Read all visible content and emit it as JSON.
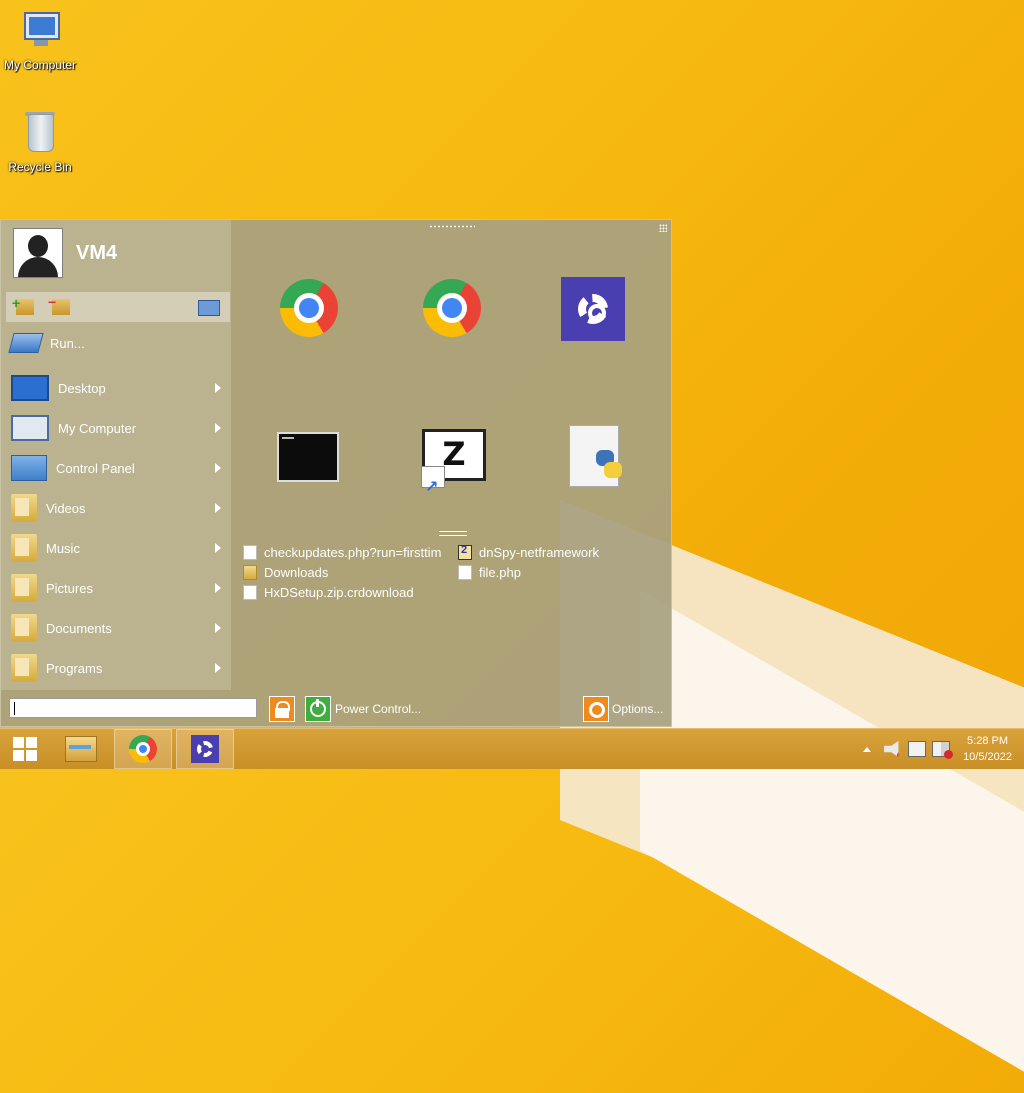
{
  "desktop": {
    "icons": [
      {
        "label": "My Computer",
        "icon": "computer-icon"
      },
      {
        "label": "Recycle Bin",
        "icon": "recycle-bin-icon"
      }
    ]
  },
  "start_menu": {
    "user": {
      "name": "VM4"
    },
    "items": [
      {
        "label": "Run...",
        "icon": "run-icon",
        "has_submenu": false
      },
      {
        "label": "Desktop",
        "icon": "desktop-icon",
        "has_submenu": true
      },
      {
        "label": "My Computer",
        "icon": "computer-icon",
        "has_submenu": true
      },
      {
        "label": "Control Panel",
        "icon": "control-panel-icon",
        "has_submenu": true
      },
      {
        "label": "Videos",
        "icon": "folder-icon",
        "has_submenu": true
      },
      {
        "label": "Music",
        "icon": "folder-icon",
        "has_submenu": true
      },
      {
        "label": "Pictures",
        "icon": "folder-icon",
        "has_submenu": true
      },
      {
        "label": "Documents",
        "icon": "folder-icon",
        "has_submenu": true
      },
      {
        "label": "Programs",
        "icon": "folder-icon",
        "has_submenu": true
      }
    ],
    "tiles": [
      {
        "icon": "chrome-icon"
      },
      {
        "icon": "chrome-icon"
      },
      {
        "icon": "settings-gear-icon"
      },
      {
        "icon": "command-prompt-icon"
      },
      {
        "icon": "filezilla-icon",
        "glyph": "Z"
      },
      {
        "icon": "python-script-icon"
      }
    ],
    "recent_left": [
      {
        "label": "checkupdates.php?run=firsttim",
        "icon": "php-file-icon"
      },
      {
        "label": "Downloads",
        "icon": "folder-icon"
      },
      {
        "label": "HxDSetup.zip.crdownload",
        "icon": "file-icon"
      }
    ],
    "recent_right": [
      {
        "label": "dnSpy-netframework",
        "icon": "archive-icon"
      },
      {
        "label": "file.php",
        "icon": "file-icon"
      }
    ],
    "search": {
      "value": "",
      "placeholder": ""
    },
    "power_label": "Power Control...",
    "options_label": "Options..."
  },
  "taskbar": {
    "pinned": [
      "file-explorer-icon",
      "chrome-icon",
      "settings-icon"
    ],
    "clock": {
      "time": "5:28 PM",
      "date": "10/5/2022"
    }
  },
  "colors": {
    "wallpaper": "#f6b80f",
    "settings_tile": "#4a3fb0",
    "accent_orange": "#ef8b1e",
    "power_green": "#3fae3f"
  }
}
